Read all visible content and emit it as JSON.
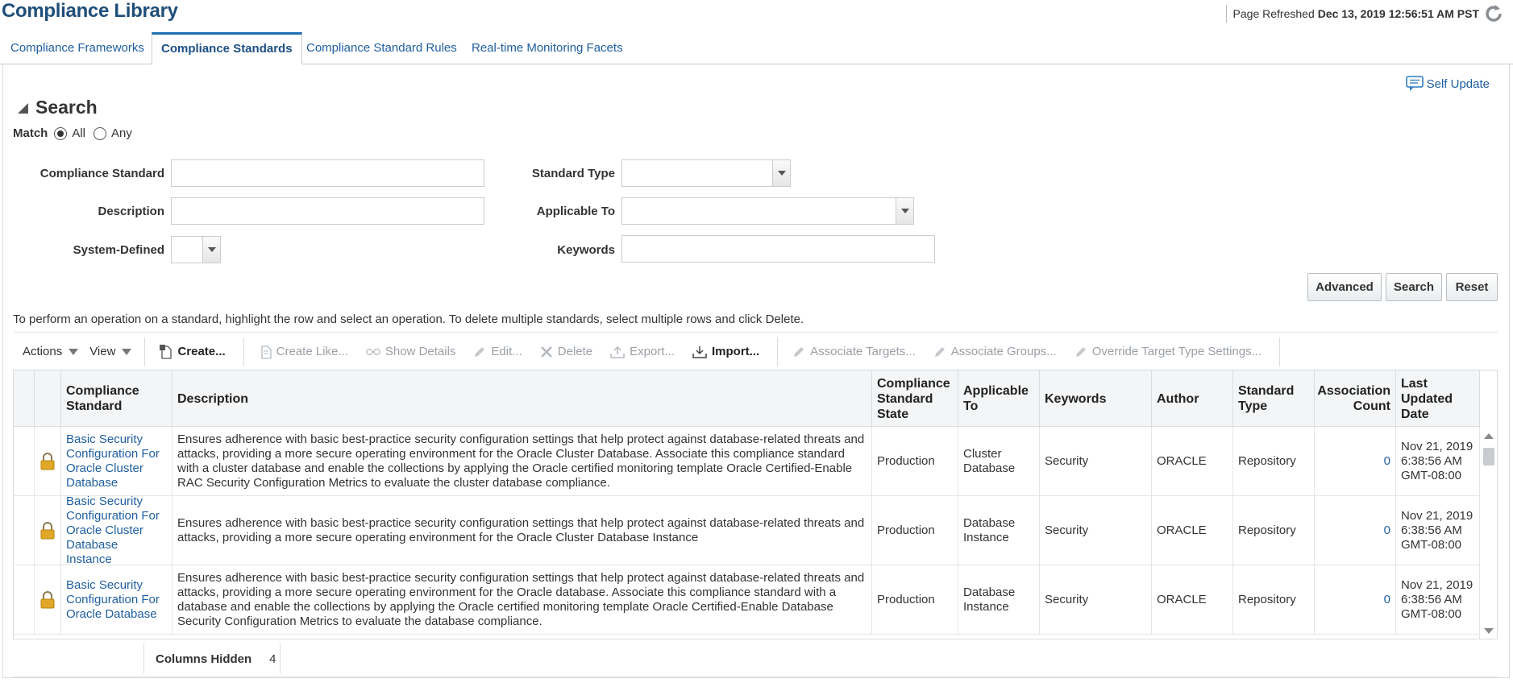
{
  "header": {
    "title": "Compliance Library",
    "refreshed_label": "Page Refreshed",
    "refreshed_value": "Dec 13, 2019 12:56:51 AM PST"
  },
  "tabs": [
    {
      "label": "Compliance Frameworks",
      "active": false
    },
    {
      "label": "Compliance Standards",
      "active": true
    },
    {
      "label": "Compliance Standard Rules",
      "active": false
    },
    {
      "label": "Real-time Monitoring Facets",
      "active": false
    }
  ],
  "self_update": "Self Update",
  "search": {
    "title": "Search",
    "match_label": "Match",
    "match_all": "All",
    "match_any": "Any",
    "match_selected": "All",
    "fields": {
      "compliance_standard": {
        "label": "Compliance Standard",
        "value": ""
      },
      "description": {
        "label": "Description",
        "value": ""
      },
      "system_defined": {
        "label": "System-Defined",
        "value": ""
      },
      "standard_type": {
        "label": "Standard Type",
        "value": ""
      },
      "applicable_to": {
        "label": "Applicable To",
        "value": ""
      },
      "keywords": {
        "label": "Keywords",
        "value": ""
      }
    },
    "buttons": {
      "advanced": "Advanced",
      "search": "Search",
      "reset": "Reset"
    }
  },
  "instruction": "To perform an operation on a standard, highlight the row and select an operation. To delete multiple standards, select multiple rows and click Delete.",
  "toolbar": {
    "actions": "Actions",
    "view": "View",
    "create": "Create...",
    "create_like": "Create Like...",
    "show_details": "Show Details",
    "edit": "Edit...",
    "delete": "Delete",
    "export": "Export...",
    "import": "Import...",
    "associate_targets": "Associate Targets...",
    "associate_groups": "Associate Groups...",
    "override": "Override Target Type Settings..."
  },
  "table": {
    "columns": {
      "standard": "Compliance Standard",
      "description": "Description",
      "state": "Compliance Standard State",
      "applicable": "Applicable To",
      "keywords": "Keywords",
      "author": "Author",
      "type": "Standard Type",
      "assoc": "Association Count",
      "updated": "Last Updated Date"
    },
    "rows": [
      {
        "standard": "Basic Security Configuration For Oracle Cluster Database",
        "description": "Ensures adherence with basic best-practice security configuration settings that help protect against database-related threats and attacks, providing a more secure operating environment for the Oracle Cluster Database. Associate this compliance standard with a cluster database and enable the collections by applying the Oracle certified monitoring template Oracle Certified-Enable RAC Security Configuration Metrics to evaluate the cluster database compliance.",
        "state": "Production",
        "applicable": "Cluster Database",
        "keywords": "Security",
        "author": "ORACLE",
        "type": "Repository",
        "assoc": "0",
        "updated": "Nov 21, 2019 6:38:56 AM GMT-08:00"
      },
      {
        "standard": "Basic Security Configuration For Oracle Cluster Database Instance",
        "description": "Ensures adherence with basic best-practice security configuration settings that help protect against database-related threats and attacks, providing a more secure operating environment for the Oracle Cluster Database Instance",
        "state": "Production",
        "applicable": "Database Instance",
        "keywords": "Security",
        "author": "ORACLE",
        "type": "Repository",
        "assoc": "0",
        "updated": "Nov 21, 2019 6:38:56 AM GMT-08:00"
      },
      {
        "standard": "Basic Security Configuration For Oracle Database",
        "description": "Ensures adherence with basic best-practice security configuration settings that help protect against database-related threats and attacks, providing a more secure operating environment for the Oracle database. Associate this compliance standard with a database and enable the collections by applying the Oracle certified monitoring template Oracle Certified-Enable Database Security Configuration Metrics to evaluate the database compliance.",
        "state": "Production",
        "applicable": "Database Instance",
        "keywords": "Security",
        "author": "ORACLE",
        "type": "Repository",
        "assoc": "0",
        "updated": "Nov 21, 2019 6:38:56 AM GMT-08:00"
      }
    ]
  },
  "footer": {
    "columns_hidden_label": "Columns Hidden",
    "columns_hidden_value": "4"
  },
  "colors": {
    "link": "#1f5fa0",
    "title": "#1f4e79",
    "lock": "#e0a826"
  }
}
